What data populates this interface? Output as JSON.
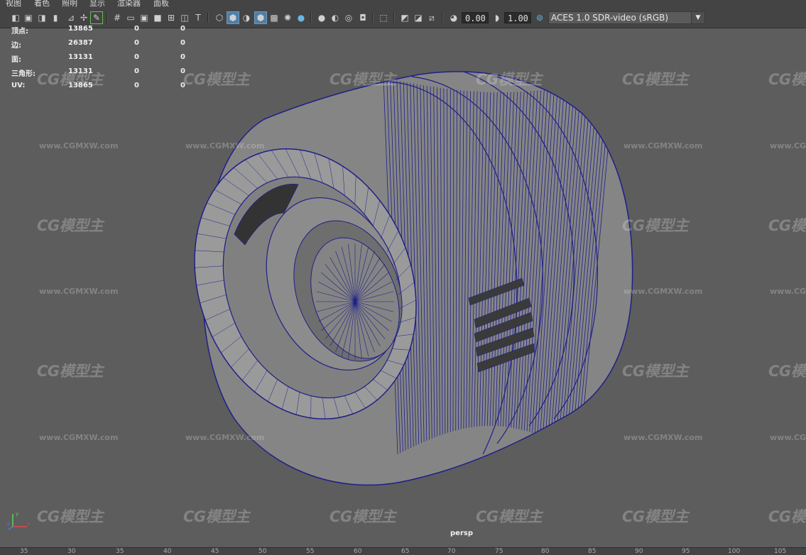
{
  "menu": [
    "视图",
    "着色",
    "照明",
    "显示",
    "渲染器",
    "面板"
  ],
  "toolbar": {
    "gamma_value": "0.00",
    "exposure_value": "1.00",
    "color_space": "ACES 1.0 SDR-video (sRGB)",
    "icons": [
      "camera-icon",
      "camera-attributes-icon",
      "film-gate-icon",
      "bookmark-icon",
      "image-plane-icon",
      "grid-icon",
      "film-gate-toggle-icon",
      "resolution-gate-icon",
      "gate-mask-icon",
      "field-chart-icon",
      "safe-action-icon",
      "safe-title-icon",
      "wireframe-icon",
      "smooth-shade-icon",
      "default-material-icon",
      "wireframe-on-shaded-icon",
      "textured-icon",
      "lights-icon",
      "shadows-icon",
      "screen-space-ao-icon",
      "motion-blur-icon",
      "anti-aliasing-icon",
      "depth-of-field-icon",
      "isolate-select-icon",
      "xray-icon",
      "xray-joints-icon",
      "xray-components-icon",
      "gamma-icon",
      "exposure-icon",
      "color-management-icon"
    ]
  },
  "hud": {
    "rows": [
      {
        "label": "顶点:",
        "value": "13865",
        "a": "0",
        "b": "0"
      },
      {
        "label": "边:",
        "value": "26387",
        "a": "0",
        "b": "0"
      },
      {
        "label": "面:",
        "value": "13131",
        "a": "0",
        "b": "0"
      },
      {
        "label": "三角形:",
        "value": "13131",
        "a": "0",
        "b": "0"
      },
      {
        "label": "UV:",
        "value": "13865",
        "a": "0",
        "b": "0"
      }
    ]
  },
  "viewport": {
    "camera": "persp",
    "background_color": "#5d5d5d",
    "wire_color": "#1f1f8a",
    "mesh_color": "#8e8e8e"
  },
  "watermark": {
    "logo": "CG模型主",
    "url": "www.CGMXW.com"
  },
  "axis": {
    "y": "y",
    "x": "x",
    "z": "z"
  },
  "timeline": [
    "35",
    "30",
    "35",
    "40",
    "45",
    "50",
    "55",
    "60",
    "65",
    "70",
    "75",
    "80",
    "85",
    "90",
    "95",
    "100",
    "105"
  ]
}
